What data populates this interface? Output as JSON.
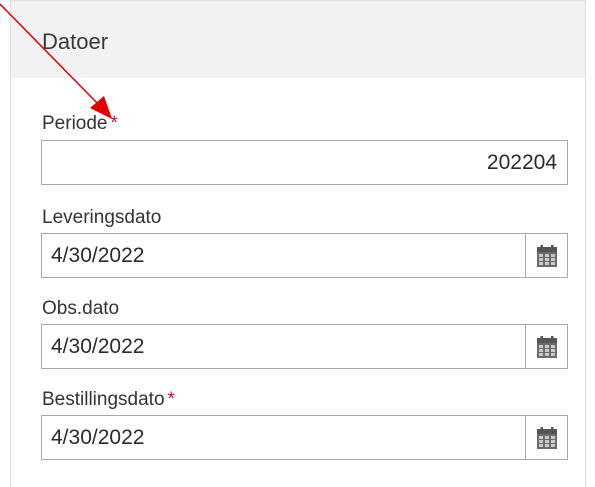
{
  "panel": {
    "title": "Datoer"
  },
  "fields": {
    "periode": {
      "label": "Periode",
      "required_marker": "*",
      "value": "202204"
    },
    "leveringsdato": {
      "label": "Leveringsdato",
      "value": "4/30/2022",
      "icon": "calendar-icon"
    },
    "obs_dato": {
      "label": "Obs.dato",
      "value": "4/30/2022",
      "icon": "calendar-icon"
    },
    "bestillingsdato": {
      "label": "Bestillingsdato",
      "required_marker": "*",
      "value": "4/30/2022",
      "icon": "calendar-icon"
    }
  },
  "colors": {
    "header_bg": "#f2f2f2",
    "required": "#c8102e",
    "annotation_arrow": "#e00000"
  }
}
